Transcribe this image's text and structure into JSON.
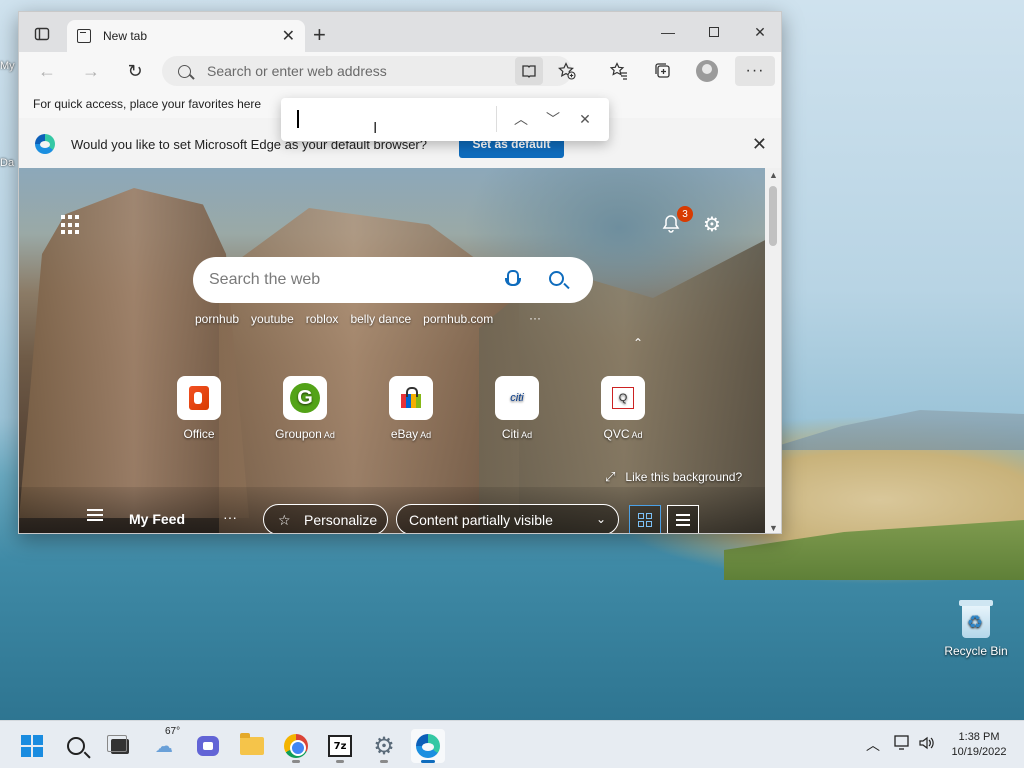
{
  "desktop": {
    "left_labels": [
      "My",
      "Da"
    ],
    "recycle_bin_label": "Recycle Bin"
  },
  "browser": {
    "tab_title": "New tab",
    "address_placeholder": "Search or enter web address",
    "favorites_bar_text": "For quick access, place your favorites here",
    "infobar": {
      "message": "Would you like to set Microsoft Edge as your default browser?",
      "set_default_label": "Set as default"
    },
    "find": {
      "value": ""
    },
    "ntp": {
      "notification_count": "3",
      "search_placeholder": "Search the web",
      "trending": [
        "pornhub",
        "youtube",
        "roblox",
        "belly dance",
        "pornhub.com"
      ],
      "trending_more": "···",
      "quick_links": [
        {
          "label": "Office",
          "ad": ""
        },
        {
          "label": "Groupon",
          "ad": "Ad"
        },
        {
          "label": "eBay",
          "ad": "Ad"
        },
        {
          "label": "Citi",
          "ad": "Ad"
        },
        {
          "label": "QVC",
          "ad": "Ad"
        }
      ],
      "citi_logo_text": "citi",
      "like_background": "Like this background?",
      "feed": {
        "title": "My Feed",
        "more": "···",
        "personalize_label": "Personalize",
        "visibility_label": "Content partially visible"
      }
    }
  },
  "taskbar": {
    "weather_temp": "67°",
    "sevenzip_label": "7z",
    "clock_time": "1:38 PM",
    "clock_date": "10/19/2022"
  },
  "colors": {
    "accent": "#0f6cbd",
    "badge": "#d83b01"
  }
}
